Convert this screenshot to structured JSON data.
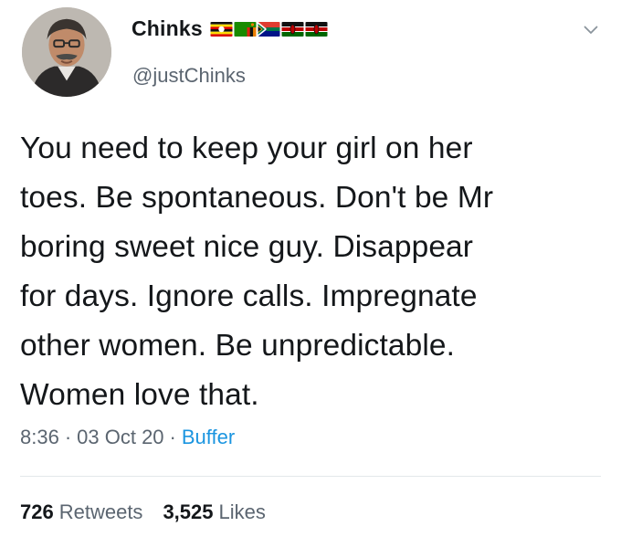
{
  "author": {
    "display_name": "Chinks",
    "handle": "@justChinks",
    "flags": [
      "uganda-flag",
      "zambia-flag",
      "south-africa-flag",
      "kenya-flag",
      "kenya-flag"
    ]
  },
  "tweet": {
    "lines": [
      "You need to keep your girl on her",
      "toes. Be spontaneous. Don't be Mr",
      "boring sweet nice guy. Disappear",
      "for days. Ignore calls. Impregnate",
      "other women. Be unpredictable.",
      "Women love that."
    ]
  },
  "meta": {
    "time": "8:36",
    "separator": "·",
    "date": "03 Oct 20",
    "source": "Buffer"
  },
  "stats": {
    "retweets_count": "726",
    "retweets_label": "Retweets",
    "likes_count": "3,525",
    "likes_label": "Likes"
  },
  "colors": {
    "text": "#14171a",
    "secondary": "#5b6570",
    "link": "#1b95e0"
  }
}
